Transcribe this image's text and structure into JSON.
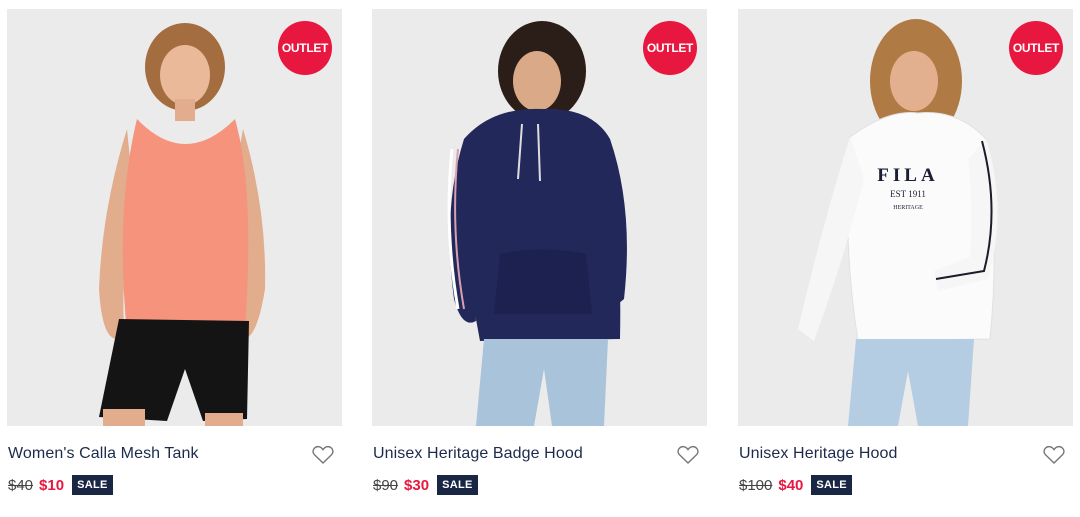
{
  "products": [
    {
      "title": "Women's Calla Mesh Tank",
      "badge": "OUTLET",
      "old_price": "$40",
      "new_price": "$10",
      "sale_tag": "SALE",
      "icon": "heart-icon"
    },
    {
      "title": "Unisex Heritage Badge Hood",
      "badge": "OUTLET",
      "old_price": "$90",
      "new_price": "$30",
      "sale_tag": "SALE",
      "icon": "heart-icon"
    },
    {
      "title": "Unisex Heritage Hood",
      "badge": "OUTLET",
      "old_price": "$100",
      "new_price": "$40",
      "sale_tag": "SALE",
      "icon": "heart-icon",
      "print_text": [
        "FILA",
        "EST 1911",
        "HERITAGE"
      ]
    }
  ],
  "colors": {
    "badge_red": "#e8173f",
    "sale_navy": "#1a2744",
    "photo_bg": "#ebebeb"
  }
}
